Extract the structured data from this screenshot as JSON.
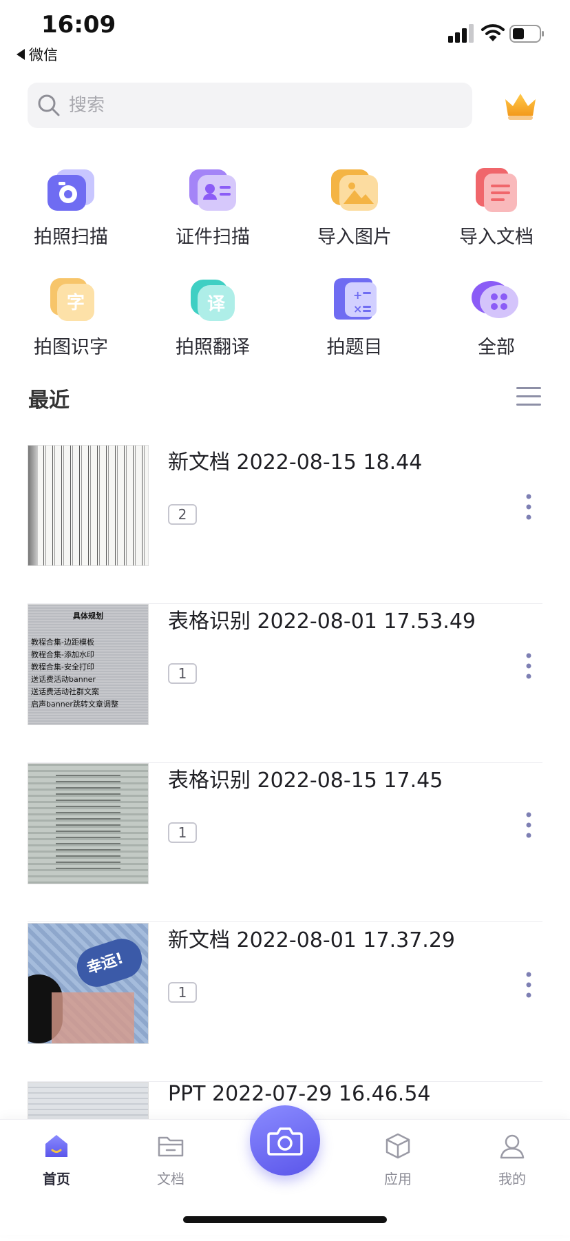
{
  "status_bar": {
    "time": "16:09",
    "back_label": "微信"
  },
  "search": {
    "placeholder": "搜索"
  },
  "features": [
    {
      "label": "拍照扫描",
      "icon": "camera-scan-icon",
      "color": "#6f6cf2"
    },
    {
      "label": "证件扫描",
      "icon": "id-card-icon",
      "color": "#8b5cf6"
    },
    {
      "label": "导入图片",
      "icon": "image-import-icon",
      "color": "#f4b444"
    },
    {
      "label": "导入文档",
      "icon": "document-import-icon",
      "color": "#f0666b"
    },
    {
      "label": "拍图识字",
      "icon": "text-recognition-icon",
      "color": "#f4b444",
      "glyph": "字"
    },
    {
      "label": "拍照翻译",
      "icon": "translate-icon",
      "color": "#3fcfc3",
      "glyph": "译"
    },
    {
      "label": "拍题目",
      "icon": "math-icon",
      "color": "#6f6cf2"
    },
    {
      "label": "全部",
      "icon": "all-apps-icon",
      "color": "#8b5cf6"
    }
  ],
  "recent": {
    "title": "最近",
    "items": [
      {
        "title": "新文档 2022-08-15 18.44",
        "pages": "2"
      },
      {
        "title": "表格识别 2022-08-01 17.53.49",
        "pages": "1",
        "thumb_lines": [
          "具体规划",
          "教程合集-边距模板",
          "教程合集-添加水印",
          "教程合集-安全打印",
          "送话费活动banner",
          "送话费活动社群文案",
          "启声banner跳转文章调整"
        ]
      },
      {
        "title": "表格识别 2022-08-15 17.45",
        "pages": "1"
      },
      {
        "title": "新文档 2022-08-01 17.37.29",
        "pages": "1",
        "thumb_text": "幸运!"
      },
      {
        "title": "PPT 2022-07-29 16.46.54",
        "pages": ""
      }
    ]
  },
  "bottom_nav": {
    "tabs": [
      {
        "label": "首页",
        "icon": "home-icon",
        "active": true
      },
      {
        "label": "文档",
        "icon": "folder-icon",
        "active": false
      },
      {
        "label": "应用",
        "icon": "cube-icon",
        "active": false
      },
      {
        "label": "我的",
        "icon": "profile-icon",
        "active": false
      }
    ],
    "camera": "camera-icon"
  },
  "colors": {
    "accent": "#5b56ea",
    "accent_light": "#8a8bff",
    "crown": "#f5a623"
  }
}
